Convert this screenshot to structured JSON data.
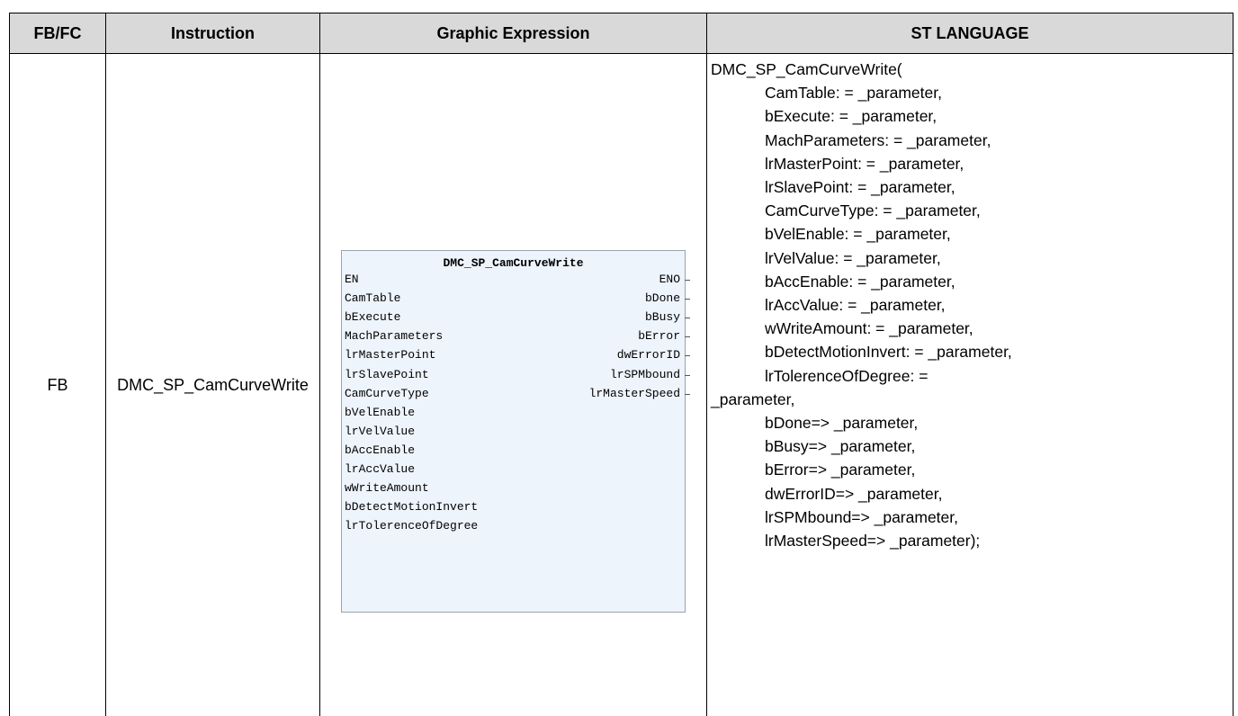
{
  "table": {
    "headers": [
      "FB/FC",
      "Instruction",
      "Graphic Expression",
      "ST LANGUAGE"
    ],
    "row": {
      "type": "FB",
      "instruction": "DMC_SP_CamCurveWrite"
    }
  },
  "fb_graphic": {
    "title": "DMC_SP_CamCurveWrite",
    "inputs": [
      "EN",
      "CamTable",
      "bExecute",
      "MachParameters",
      "lrMasterPoint",
      "lrSlavePoint",
      "CamCurveType",
      "bVelEnable",
      "lrVelValue",
      "bAccEnable",
      "lrAccValue",
      "wWriteAmount",
      "bDetectMotionInvert",
      "lrTolerenceOfDegree"
    ],
    "outputs": [
      "ENO",
      "bDone",
      "bBusy",
      "bError",
      "dwErrorID",
      "lrSPMbound",
      "lrMasterSpeed"
    ]
  },
  "st_code": {
    "header": "DMC_SP_CamCurveWrite(",
    "lines": [
      "CamTable: = _parameter,",
      "bExecute: = _parameter,",
      "MachParameters: = _parameter,",
      "lrMasterPoint: = _parameter,",
      "lrSlavePoint: = _parameter,",
      "CamCurveType: = _parameter,",
      "bVelEnable: = _parameter,",
      "lrVelValue: = _parameter,",
      "bAccEnable: = _parameter,",
      "lrAccValue: = _parameter,",
      "wWriteAmount: = _parameter,",
      "bDetectMotionInvert: = _parameter,",
      "lrTolerenceOfDegree: ="
    ],
    "wrap": "_parameter,",
    "outputs_lines": [
      "bDone=> _parameter,",
      "bBusy=> _parameter,",
      "bError=> _parameter,",
      "dwErrorID=> _parameter,",
      "lrSPMbound=> _parameter,",
      "lrMasterSpeed=> _parameter);"
    ]
  },
  "colors": {
    "header_bg": "#d9d9d9",
    "border": "#000000",
    "fb_bg": "#eef4fc"
  }
}
